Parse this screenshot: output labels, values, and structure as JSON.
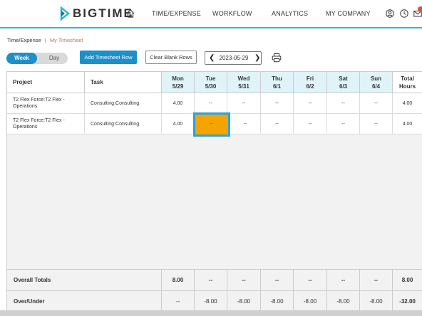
{
  "nav": {
    "brand": "BIGTIME",
    "items": [
      "TIME/EXPENSE",
      "WORKFLOW",
      "ANALYTICS",
      "MY COMPANY"
    ]
  },
  "breadcrumb": {
    "parent": "Time/Expense",
    "separator": "|",
    "current": "My Timesheet"
  },
  "view_toggle": {
    "week": "Week",
    "day": "Day",
    "selected": "Week"
  },
  "buttons": {
    "add_row": "Add Timesheet Row",
    "clear_blank": "Clear Blank Rows"
  },
  "date_picker": {
    "prev": "❮",
    "value": "2023-05-29",
    "next": "❯"
  },
  "grid": {
    "headers": {
      "project": "Project",
      "task": "Task",
      "days": [
        {
          "name": "Mon",
          "date": "5/29"
        },
        {
          "name": "Tue",
          "date": "5/30"
        },
        {
          "name": "Wed",
          "date": "5/31"
        },
        {
          "name": "Thu",
          "date": "6/1"
        },
        {
          "name": "Fri",
          "date": "6/2"
        },
        {
          "name": "Sat",
          "date": "6/3"
        },
        {
          "name": "Sun",
          "date": "6/4"
        }
      ],
      "total": "Total",
      "total_sub": "Hours"
    },
    "rows": [
      {
        "project": "T2 Flex Force:T2 Flex - Operations",
        "task": "Consulting:Consulting",
        "values": [
          "4.00",
          "--",
          "--",
          "--",
          "--",
          "--",
          "--"
        ],
        "total": "4.00"
      },
      {
        "project": "T2 Flex Force:T2 Flex - Operations",
        "task": "Consulting:Consulting",
        "values": [
          "4.00",
          "--",
          "--",
          "--",
          "--",
          "--",
          "--"
        ],
        "total": "4.00"
      }
    ],
    "overall_totals": {
      "label": "Overall Totals",
      "values": [
        "8.00",
        "--",
        "--",
        "--",
        "--",
        "--",
        "--"
      ],
      "total": "8.00"
    },
    "over_under": {
      "label": "Over/Under",
      "values": [
        "--",
        "-8.00",
        "-8.00",
        "-8.00",
        "-8.00",
        "-8.00",
        "-8.00"
      ],
      "total": "-32.00"
    }
  },
  "colors": {
    "accent": "#1d8fc9",
    "header_day_bg": "#dff3f8",
    "selected_cell": "#f5a300",
    "selected_border": "#29a3de",
    "nav_underline": "#2fb6d3"
  }
}
